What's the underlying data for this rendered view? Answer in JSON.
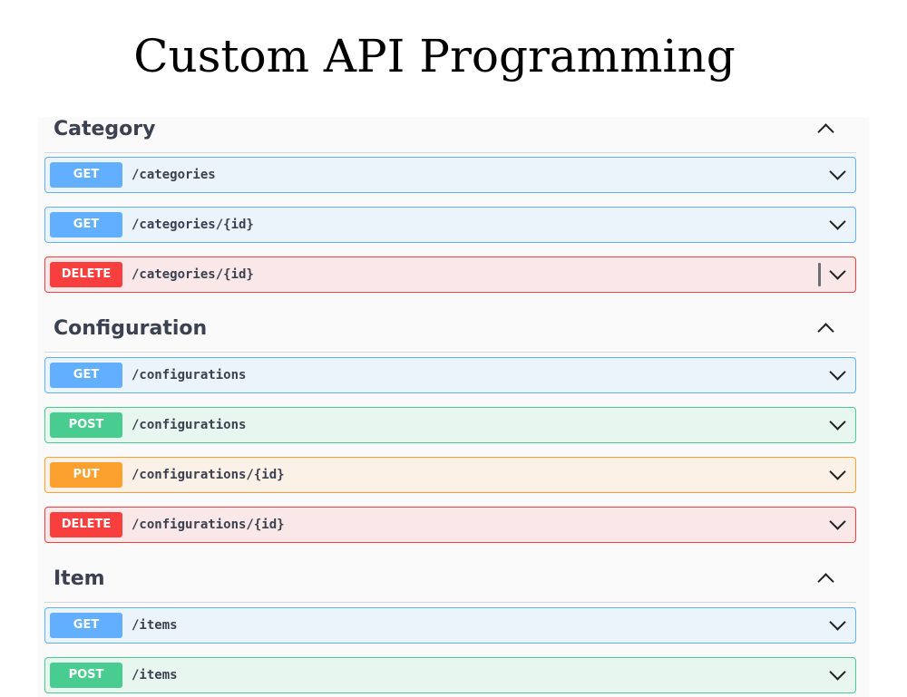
{
  "page": {
    "title": "Custom API Programming"
  },
  "sections": [
    {
      "name": "Category",
      "operations": [
        {
          "method": "GET",
          "path": "/categories"
        },
        {
          "method": "GET",
          "path": "/categories/{id}"
        },
        {
          "method": "DELETE",
          "path": "/categories/{id}"
        }
      ]
    },
    {
      "name": "Configuration",
      "operations": [
        {
          "method": "GET",
          "path": "/configurations"
        },
        {
          "method": "POST",
          "path": "/configurations"
        },
        {
          "method": "PUT",
          "path": "/configurations/{id}"
        },
        {
          "method": "DELETE",
          "path": "/configurations/{id}"
        }
      ]
    },
    {
      "name": "Item",
      "operations": [
        {
          "method": "GET",
          "path": "/items"
        },
        {
          "method": "POST",
          "path": "/items"
        }
      ]
    }
  ],
  "colors": {
    "get": "#61affe",
    "post": "#49cc90",
    "put": "#fca130",
    "delete": "#f93e3e",
    "section_title": "#3b4151"
  },
  "icons": {
    "section_toggle": "chevron-up-icon",
    "operation_toggle": "chevron-down-icon"
  }
}
